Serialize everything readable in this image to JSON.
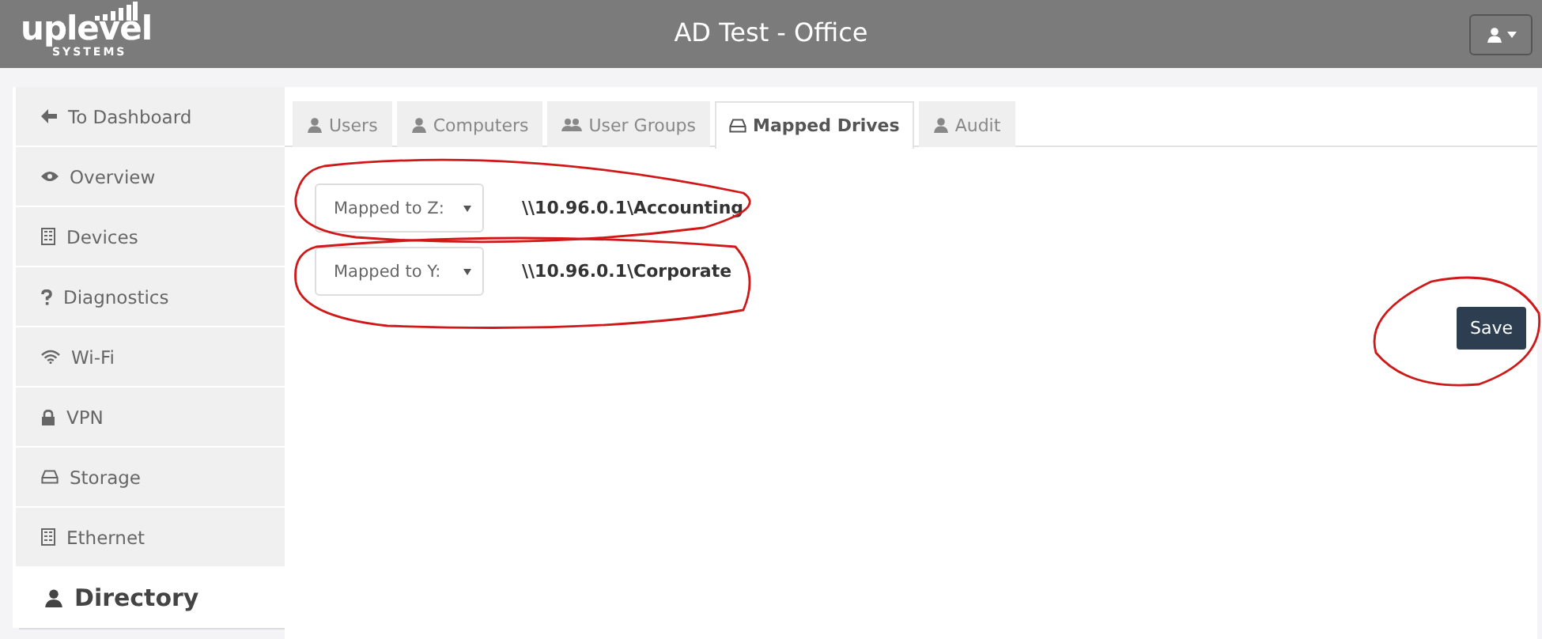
{
  "header": {
    "logo": "uplevel",
    "logo_sub": "SYSTEMS",
    "title": "AD Test - Office"
  },
  "sidebar": {
    "items": [
      {
        "label": "To Dashboard",
        "selected": false
      },
      {
        "label": "Overview",
        "selected": false
      },
      {
        "label": "Devices",
        "selected": false
      },
      {
        "label": "Diagnostics",
        "selected": false
      },
      {
        "label": "Wi-Fi",
        "selected": false
      },
      {
        "label": "VPN",
        "selected": false
      },
      {
        "label": "Storage",
        "selected": false
      },
      {
        "label": "Ethernet",
        "selected": false
      },
      {
        "label": "Directory",
        "selected": true
      }
    ]
  },
  "tabs": [
    {
      "label": "Users",
      "selected": false
    },
    {
      "label": "Computers",
      "selected": false
    },
    {
      "label": "User Groups",
      "selected": false
    },
    {
      "label": "Mapped Drives",
      "selected": true
    },
    {
      "label": "Audit",
      "selected": false
    }
  ],
  "drives": [
    {
      "mapping": "Mapped to Z:",
      "path": "\\\\10.96.0.1\\Accounting"
    },
    {
      "mapping": "Mapped to Y:",
      "path": "\\\\10.96.0.1\\Corporate"
    }
  ],
  "save_button": "Save"
}
